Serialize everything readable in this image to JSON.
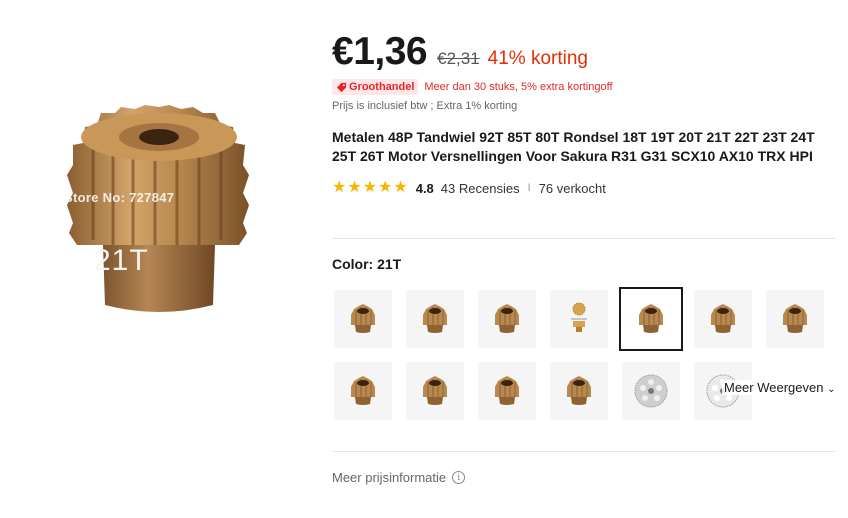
{
  "product_image": {
    "watermark": "Store No: 727847",
    "teeth_label": "21T"
  },
  "price": {
    "current": "€1,36",
    "original": "€2,31",
    "discount": "41% korting"
  },
  "promo": {
    "badge": "Groothandel",
    "text": "Meer dan 30 stuks, 5% extra kortingoff"
  },
  "tax_note": "Prijs is inclusief btw ; Extra 1% korting",
  "title": "Metalen 48P Tandwiel 92T 85T 80T Rondsel 18T 19T 20T 21T 22T 23T 24T 25T 26T Motor Versnellingen Voor Sakura R31 G31 SCX10 AX10 TRX HPI",
  "rating": {
    "stars": 5,
    "score": "4.8",
    "reviews": "43 Recensies",
    "separator": "I",
    "sold": "76 verkocht"
  },
  "color": {
    "label": "Color: 21T",
    "selected_index": 4,
    "swatch_kinds": [
      "gear",
      "gear",
      "gear",
      "diagram",
      "gear",
      "gear",
      "gear",
      "gear",
      "gear",
      "gear",
      "gear",
      "spur-steel",
      "spur-white"
    ]
  },
  "more_button": "Meer Weergeven",
  "more_icon": "chevron-down-icon",
  "price_info": "Meer prijsinformatie",
  "colors": {
    "accent": "#e62e04",
    "promo_red": "#e02828",
    "badge_bg": "#ffe7e9",
    "star": "#f7b500",
    "gear_bronze": "#b98a50"
  }
}
